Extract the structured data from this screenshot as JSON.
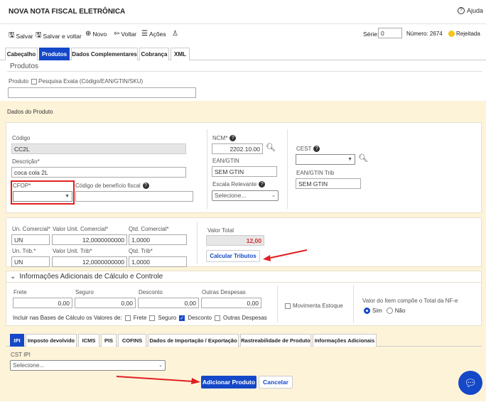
{
  "header": {
    "title": "NOVA NOTA FISCAL ELETRÔNICA",
    "help_label": "Ajuda"
  },
  "toolbar": {
    "save_label": "Salvar",
    "save_back_label": "Salvar e voltar",
    "new_label": "Novo",
    "back_label": "Voltar",
    "actions_label": "Ações",
    "serie_label": "Série:",
    "serie_value": "0",
    "numero_label": "Número: 2674",
    "status_label": "Rejeitada",
    "status_color": "#f5c518"
  },
  "tabs": [
    "Cabeçalho",
    "Produtos",
    "Dados Complementares",
    "Cobrança",
    "XML"
  ],
  "produtos": {
    "section_title": "Produtos",
    "produto_label": "Produto",
    "exact_search_label": "Pesquisa Exata (Código/EAN/GTIN/SKU)",
    "produto_value": ""
  },
  "dados": {
    "title": "Dados do Produto",
    "codigo_label": "Código",
    "codigo_value": "CC2L",
    "descricao_label": "Descrição*",
    "descricao_value": "coca cola 2L",
    "cfop_label": "CFOP*",
    "beneficio_label": "Código de benefício fiscal",
    "ncm_label": "NCM*",
    "ncm_value": "2202.10.00",
    "ean_label": "EAN/GTIN",
    "ean_value": "SEM GTIN",
    "escala_label": "Escala Relevante",
    "escala_value": "Selecione...",
    "cest_label": "CEST",
    "ean_trib_label": "EAN/GTIN Trib",
    "ean_trib_value": "SEM GTIN"
  },
  "quantidades": {
    "un_com_label": "Un. Comercial*",
    "un_com_value": "UN",
    "valor_com_label": "Valor Unit. Comercial*",
    "valor_com_value": "12,0000000000",
    "qtd_com_label": "Qtd. Comercial*",
    "qtd_com_value": "1,0000",
    "un_trib_label": "Un. Trib.*",
    "un_trib_value": "UN",
    "valor_trib_label": "Valor Unit. Trib*",
    "valor_trib_value": "12,0000000000",
    "qtd_trib_label": "Qtd. Trib*",
    "qtd_trib_value": "1,0000",
    "valor_total_label": "Valor Total",
    "valor_total_value": "12,00",
    "calc_button": "Calcular Tributos"
  },
  "info_adicionais": {
    "title": "Informações Adicionais de Cálculo e Controle",
    "frete_label": "Frete",
    "frete_value": "0,00",
    "seguro_label": "Seguro",
    "seguro_value": "0,00",
    "desconto_label": "Desconto",
    "desconto_value": "0,00",
    "outras_label": "Outras Despesas",
    "outras_value": "0,00",
    "incluir_label": "Incluir nas Bases de Cálculo os Valores de:",
    "chk_frete": "Frete",
    "chk_seguro": "Seguro",
    "chk_desconto": "Desconto",
    "chk_outras": "Outras Despesas",
    "movimenta_label": "Movimenta Estoque",
    "compoe_label": "Valor do Item compõe o Total da NF-e",
    "sim_label": "Sim",
    "nao_label": "Não"
  },
  "bottom_tabs": [
    "IPI",
    "Imposto devolvido",
    "ICMS",
    "PIS",
    "COFINS",
    "Dados de Importação / Exportação",
    "Rastreabilidade de Produto",
    "Informações Adicionais"
  ],
  "ipi": {
    "cst_label": "CST IPI",
    "cst_value": "Selecione..."
  },
  "actions": {
    "add_label": "Adicionar Produto",
    "cancel_label": "Cancelar"
  },
  "colors": {
    "primary": "#1548c8",
    "highlight": "#e02020",
    "panel_bg": "#fdf3d9"
  }
}
